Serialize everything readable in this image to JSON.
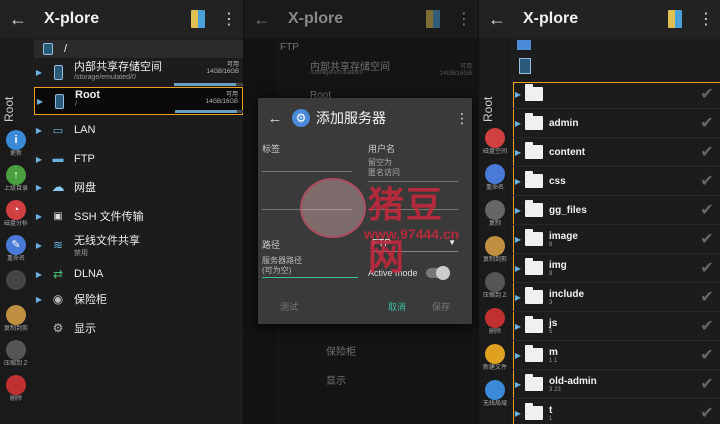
{
  "app": {
    "title": "X-plore"
  },
  "panel1": {
    "path": "/",
    "side_label": "Root",
    "tools": [
      {
        "label": "更新",
        "color": "#3a8ad8",
        "glyph": "i"
      },
      {
        "label": "上级目录",
        "color": "#4aa040",
        "glyph": "↑"
      },
      {
        "label": "磁盘分析",
        "color": "#d04040",
        "glyph": "◔"
      },
      {
        "label": "重命名",
        "color": "#4a7ad8",
        "glyph": "✎"
      },
      {
        "label": "",
        "color": "#444",
        "glyph": ""
      },
      {
        "label": "复制到剪贴板",
        "color": "#c09040",
        "glyph": ""
      },
      {
        "label": "压缩到 ZIP",
        "color": "#555",
        "glyph": ""
      },
      {
        "label": "删除",
        "color": "#c03030",
        "glyph": ""
      }
    ],
    "storage": [
      {
        "label": "内部共享存储空间",
        "path": "/storage/emulated/0",
        "available": "可用",
        "size": "14GB/16GB",
        "fill": 0.88
      },
      {
        "label": "Root",
        "path": "/",
        "available": "可用",
        "size": "14GB/16GB",
        "fill": 0.88
      }
    ],
    "items": [
      {
        "label": "LAN",
        "sub": ""
      },
      {
        "label": "FTP",
        "sub": ""
      },
      {
        "label": "网盘",
        "sub": ""
      },
      {
        "label": "SSH 文件传输",
        "sub": ""
      },
      {
        "label": "无线文件共享",
        "sub": "禁用"
      },
      {
        "label": "DLNA",
        "sub": ""
      },
      {
        "label": "保险柜",
        "sub": ""
      },
      {
        "label": "显示",
        "sub": ""
      }
    ]
  },
  "panel2": {
    "header": "FTP",
    "bg_items": [
      "内部共享存储空间",
      "/storage/emulated/0",
      "Root",
      "DLNA",
      "保险柜",
      "显示"
    ],
    "bg_caps": [
      "可用",
      "14GB/16GB"
    ],
    "bg_tool_label": "无线局域网共享"
  },
  "dialog": {
    "title": "添加服务器",
    "label_tag": "标签",
    "label_user": "用户名",
    "user_placeholder": "留空为\n匿名访问",
    "label_path": "路径",
    "protocol": "FTP",
    "path_placeholder": "服务器路径\n(可为空)",
    "active_mode": "Active mode",
    "btn_test": "测试",
    "btn_cancel": "取消",
    "btn_save": "保存"
  },
  "panel3": {
    "side_label": "Root",
    "folders": [
      {
        "name": "",
        "sub": ""
      },
      {
        "name": "admin",
        "sub": ""
      },
      {
        "name": "content",
        "sub": ""
      },
      {
        "name": "css",
        "sub": ""
      },
      {
        "name": "gg_files",
        "sub": ""
      },
      {
        "name": "image",
        "sub": "8"
      },
      {
        "name": "img",
        "sub": "9"
      },
      {
        "name": "include",
        "sub": "3"
      },
      {
        "name": "js",
        "sub": "5"
      },
      {
        "name": "m",
        "sub": "1  1"
      },
      {
        "name": "old-admin",
        "sub": "3  23"
      },
      {
        "name": "t",
        "sub": "1"
      }
    ],
    "tools": [
      {
        "label": "磁盘空间使用",
        "color": "#d04040"
      },
      {
        "label": "重命名",
        "color": "#4a7ad8"
      },
      {
        "label": "复制",
        "color": "#666"
      },
      {
        "label": "复制到剪贴板",
        "color": "#c09040"
      },
      {
        "label": "压缩到 ZIP",
        "color": "#555"
      },
      {
        "label": "删除",
        "color": "#c03030"
      },
      {
        "label": "新建文件夹",
        "color": "#e0a020"
      },
      {
        "label": "无线局域网共享",
        "color": "#3a8ad8"
      }
    ]
  },
  "watermark": {
    "text": "猪豆网",
    "url": "www.97444.cn"
  }
}
